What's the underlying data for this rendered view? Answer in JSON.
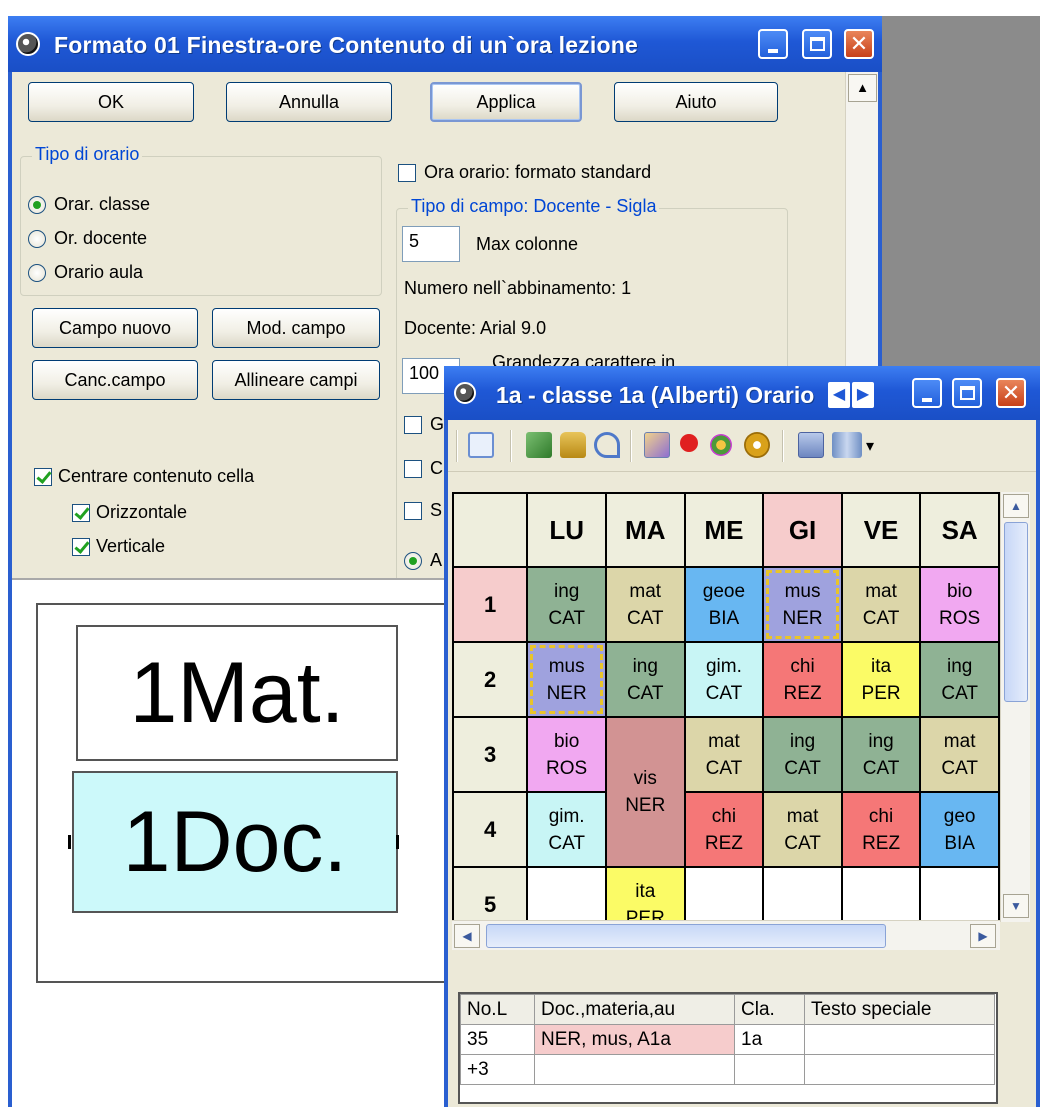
{
  "dialog": {
    "title": "Formato 01  Finestra-ore  Contenuto di un`ora lezione",
    "buttons": {
      "ok": "OK",
      "cancel": "Annulla",
      "apply": "Applica",
      "help": "Aiuto"
    },
    "schedule_type": {
      "title": "Tipo di orario",
      "options": [
        "Orar. classe",
        "Or. docente",
        "Orario aula"
      ],
      "selected": "Orar. classe"
    },
    "field_buttons": {
      "new": "Campo nuovo",
      "edit": "Mod. campo",
      "delete": "Canc.campo",
      "align": "Allineare campi"
    },
    "center_content": {
      "label": "Centrare contenuto cella",
      "horizontal": "Orizzontale",
      "vertical": "Verticale"
    },
    "standard_format": {
      "label": "Ora orario: formato standard"
    },
    "field_type": {
      "title": "Tipo di campo: Docente - Sigla",
      "max_columns_value": "5",
      "max_columns_label": "Max colonne",
      "combination_number": "Numero nell`abbinamento: 1",
      "teacher_font": "Docente: Arial 9.0",
      "font_size_value": "100",
      "font_size_unit": "%",
      "font_size_label": "Grandezza carattere in",
      "clipped_labels": [
        "G",
        "C",
        "S",
        "A"
      ]
    },
    "preview": {
      "field1": "1Mat.",
      "field2": "1Doc.",
      "field2_bg": "#ccf9fa"
    }
  },
  "class_window": {
    "title": "1a - classe 1a (Alberti)  Orario",
    "nav_prev": "◀",
    "nav_next": "▶",
    "toolbar_icons": [
      "move-icon",
      "import-icon",
      "lock-icon",
      "undo-icon",
      "paint-icon",
      "pin-icon",
      "people-icon",
      "settings-gear-icon",
      "help-icon",
      "view-icon"
    ],
    "toolbar_more": "▾",
    "days": [
      "LU",
      "MA",
      "ME",
      "GI",
      "VE",
      "SA"
    ],
    "hours": [
      "1",
      "2",
      "3",
      "4",
      "5"
    ],
    "colors": {
      "ing": "#8fb294",
      "mat": "#dcd6a9",
      "geo": "#68b7f2",
      "mus": "#9fa2de",
      "bio": "#f1a8f1",
      "gim": "#c8f5f5",
      "chi": "#f57777",
      "ita": "#fbfb66",
      "vis": "#d29393",
      "highlight": "#f6cccc",
      "sel_border": "#e8c42a"
    },
    "rows": [
      [
        {
          "a": "ing",
          "b": "CAT",
          "col": "ing"
        },
        {
          "a": "mat",
          "b": "CAT",
          "col": "mat"
        },
        {
          "a": "geoe",
          "b": "BIA",
          "col": "geo"
        },
        {
          "a": "mus",
          "b": "NER",
          "col": "mus",
          "sel": true
        },
        {
          "a": "mat",
          "b": "CAT",
          "col": "mat"
        },
        {
          "a": "bio",
          "b": "ROS",
          "col": "bio"
        }
      ],
      [
        {
          "a": "mus",
          "b": "NER",
          "col": "mus",
          "sel": true
        },
        {
          "a": "ing",
          "b": "CAT",
          "col": "ing"
        },
        {
          "a": "gim.",
          "b": "CAT",
          "col": "gim"
        },
        {
          "a": "chi",
          "b": "REZ",
          "col": "chi"
        },
        {
          "a": "ita",
          "b": "PER",
          "col": "ita"
        },
        {
          "a": "ing",
          "b": "CAT",
          "col": "ing"
        }
      ],
      [
        {
          "a": "bio",
          "b": "ROS",
          "col": "bio"
        },
        {
          "a": "vis",
          "b": "NER",
          "col": "vis",
          "span": 2
        },
        {
          "a": "mat",
          "b": "CAT",
          "col": "mat"
        },
        {
          "a": "ing",
          "b": "CAT",
          "col": "ing"
        },
        {
          "a": "ing",
          "b": "CAT",
          "col": "ing"
        },
        {
          "a": "mat",
          "b": "CAT",
          "col": "mat"
        }
      ],
      [
        {
          "a": "gim.",
          "b": "CAT",
          "col": "gim"
        },
        null,
        {
          "a": "chi",
          "b": "REZ",
          "col": "chi"
        },
        {
          "a": "mat",
          "b": "CAT",
          "col": "mat"
        },
        {
          "a": "chi",
          "b": "REZ",
          "col": "chi"
        },
        {
          "a": "geo",
          "b": "BIA",
          "col": "geo"
        }
      ],
      [
        {
          "a": "",
          "b": "",
          "col": ""
        },
        {
          "a": "ita",
          "b": "PER",
          "col": "ita"
        },
        {
          "a": "",
          "b": "",
          "col": ""
        },
        {
          "a": "",
          "b": "",
          "col": ""
        },
        {
          "a": "",
          "b": "",
          "col": ""
        },
        {
          "a": "",
          "b": "",
          "col": ""
        }
      ]
    ],
    "lesson_table": {
      "headers": [
        "No.L",
        "Doc.,materia,au",
        "Cla.",
        "Testo speciale"
      ],
      "rows": [
        [
          "35",
          "NER, mus, A1a",
          "1a",
          ""
        ],
        [
          "+3",
          "",
          "",
          ""
        ]
      ]
    }
  }
}
